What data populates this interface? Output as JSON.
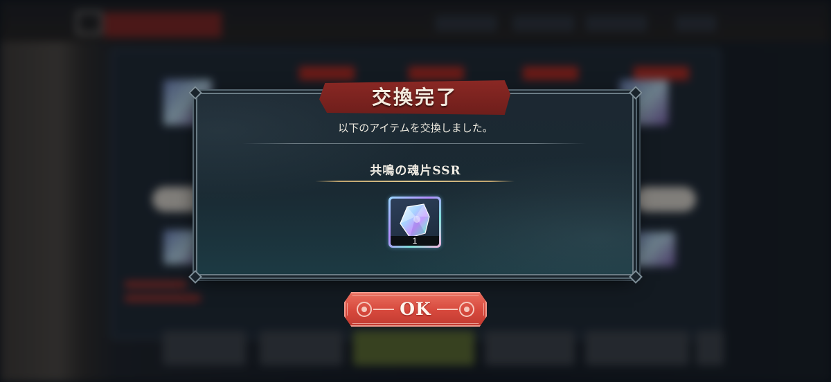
{
  "dialog": {
    "title": "交換完了",
    "message": "以下のアイテムを交換しました。",
    "item_name": "共鳴の魂片SSR",
    "item_quantity": "1",
    "item_icon": "ssr-soul-shard-crystal"
  },
  "ok_button": {
    "label": "OK"
  },
  "colors": {
    "banner_red": "#8a2824",
    "button_red": "#d6483c",
    "gold_separator": "#e0c98f",
    "dialog_bg": "#1c2832"
  }
}
